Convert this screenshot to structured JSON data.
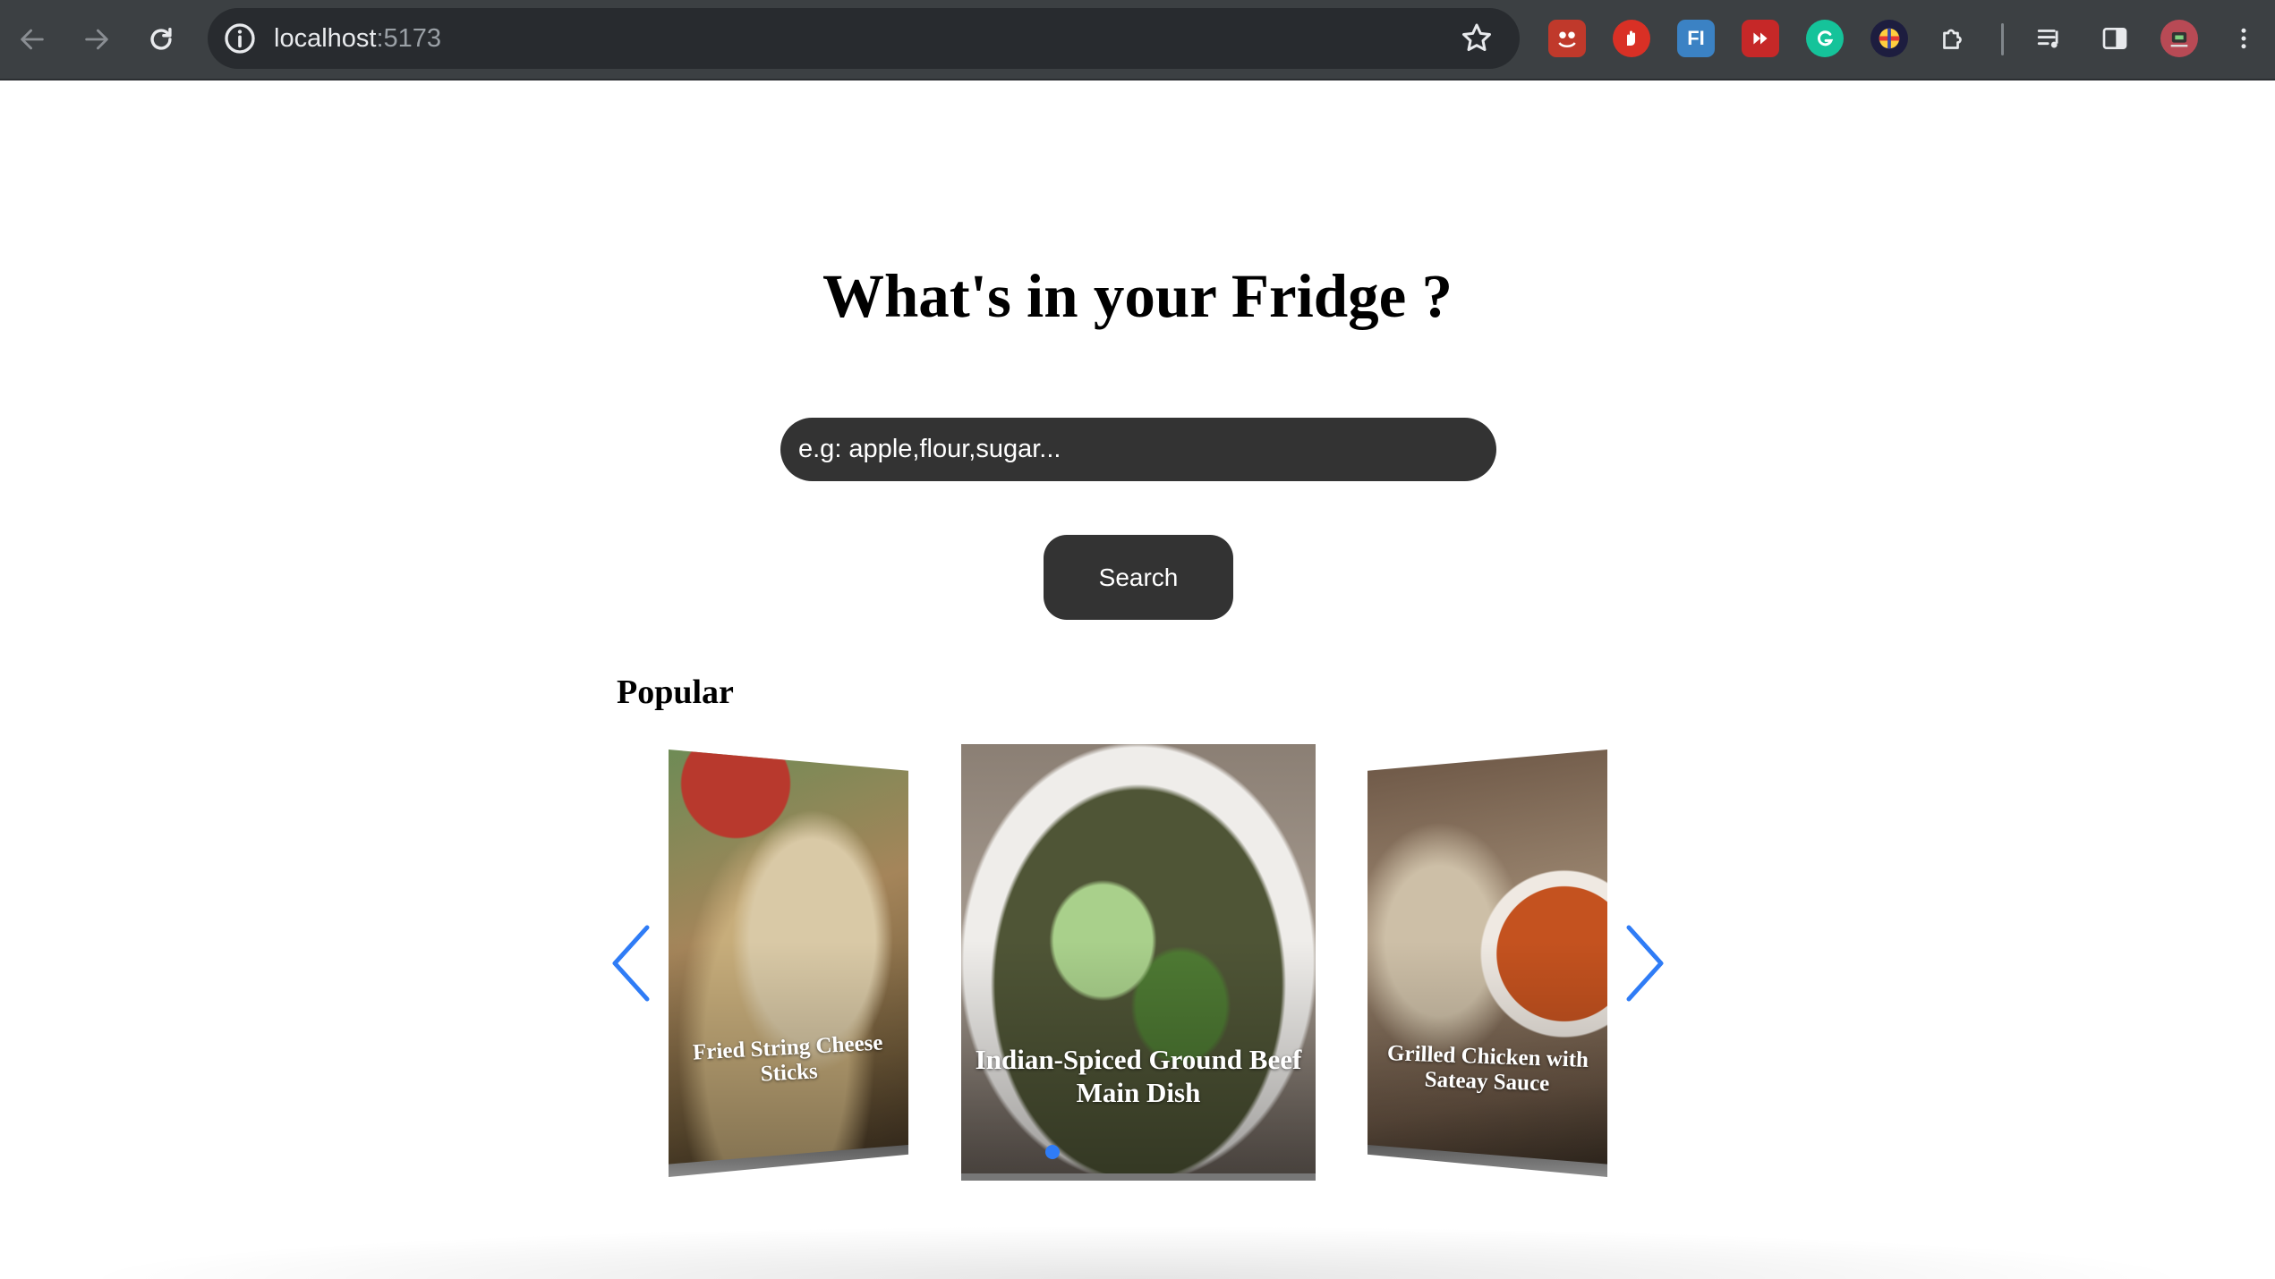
{
  "browser": {
    "url_host": "localhost",
    "url_port": ":5173",
    "extensions": [
      "toby-icon",
      "adblock-icon",
      "fi-icon",
      "video-speed-icon",
      "grammarly-icon",
      "colorful-circle-icon",
      "puzzle-extensions-icon"
    ],
    "fi_label": "FI"
  },
  "page": {
    "title": "What's in your Fridge ?",
    "search_placeholder": "e.g: apple,flour,sugar...",
    "search_button": "Search",
    "popular_heading": "Popular"
  },
  "carousel": {
    "items": [
      {
        "title": "Fried String Cheese Sticks"
      },
      {
        "title": "Indian-Spiced Ground Beef Main Dish"
      },
      {
        "title": "Grilled Chicken with Sateay Sauce"
      }
    ],
    "active_index": 1
  },
  "colors": {
    "accent": "#2f7cf6",
    "input_bg": "#333333",
    "chrome_bg": "#3c4043"
  }
}
